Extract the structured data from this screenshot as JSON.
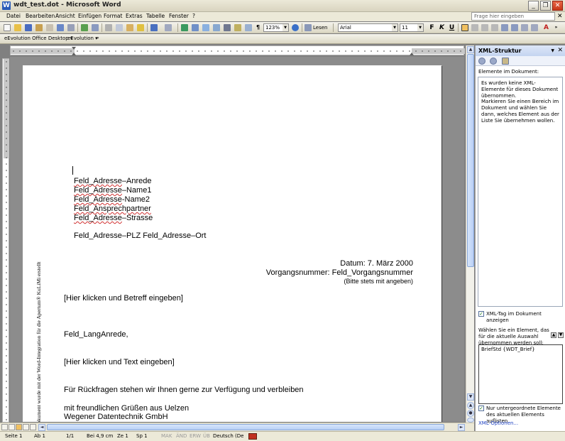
{
  "window": {
    "title": "wdt_test.dot - Microsoft Word"
  },
  "menu": {
    "items": [
      "Datei",
      "Bearbeiten",
      "Ansicht",
      "Einfügen",
      "Format",
      "Extras",
      "Tabelle",
      "Fenster",
      "?"
    ],
    "ask_placeholder": "Frage hier eingeben"
  },
  "toolbar": {
    "zoom": "123%",
    "read_label": "Lesen",
    "font": "Arial",
    "font_size": "11"
  },
  "toolbar2": {
    "desktop_label": "eEvolution Office Desktop",
    "evolution_label": "eEvolution"
  },
  "document": {
    "address_lines": [
      {
        "a": "Feld_Adresse",
        "b": "–Anrede"
      },
      {
        "a": "Feld_Adresse",
        "b": "–Name1"
      },
      {
        "a": "Feld_Adresse",
        "b": "-Name2"
      },
      {
        "a": "Feld_Ansprechpartner",
        "b": ""
      },
      {
        "a": "Feld_Adresse",
        "b": "–Strasse"
      }
    ],
    "plz_line": "Feld_Adresse–PLZ Feld_Adresse–Ort",
    "datum": "Datum: 7. März 2000",
    "vorgang": "Vorgangsnummer: Feld_Vorgangsnummer",
    "bitte": "(Bitte stets mit angeben)",
    "betreff": "[Hier klicken und Betreff eingeben]",
    "anrede": "Feld_LangAnrede,",
    "text": "[Hier klicken und Text eingeben]",
    "rueckfragen": "Für Rückfragen stehen wir Ihnen gerne zur Verfügung und verbleiben",
    "gruss": "mit freundlichen Grüßen aus Uelzen",
    "firma": "Wegener Datentechnik GmbH",
    "side_text": "Dokument wurde mit der Word-Integration für die Apertum® KuLiMi erstellt"
  },
  "pane": {
    "title": "XML-Struktur",
    "elements_label": "Elemente im Dokument:",
    "info1": "Es wurden keine XML-Elemente für dieses Dokument übernommen.",
    "info2": "Markieren Sie einen Bereich im Dokument und wählen Sie dann, welches Element aus der Liste Sie übernehmen wollen.",
    "show_tags_label": "XML-Tag im Dokument anzeigen",
    "choose_label": "Wählen Sie ein Element, das für die aktuelle Auswahl übernommen werden soll:",
    "list_item": "BriefStd {WDT_Brief}",
    "sub_only_label": "Nur untergeordnete Elemente des aktuellen Elements auflisten",
    "options_link": "XML-Optionen..."
  },
  "status": {
    "seite": "Seite 1",
    "ab": "Ab 1",
    "pages": "1/1",
    "bei": "Bei 4,9 cm",
    "ze": "Ze 1",
    "sp": "Sp 1",
    "mak": "MAK",
    "aend": "ÄND",
    "erw": "ERW",
    "ueb": "ÜB",
    "lang": "Deutsch (De"
  }
}
